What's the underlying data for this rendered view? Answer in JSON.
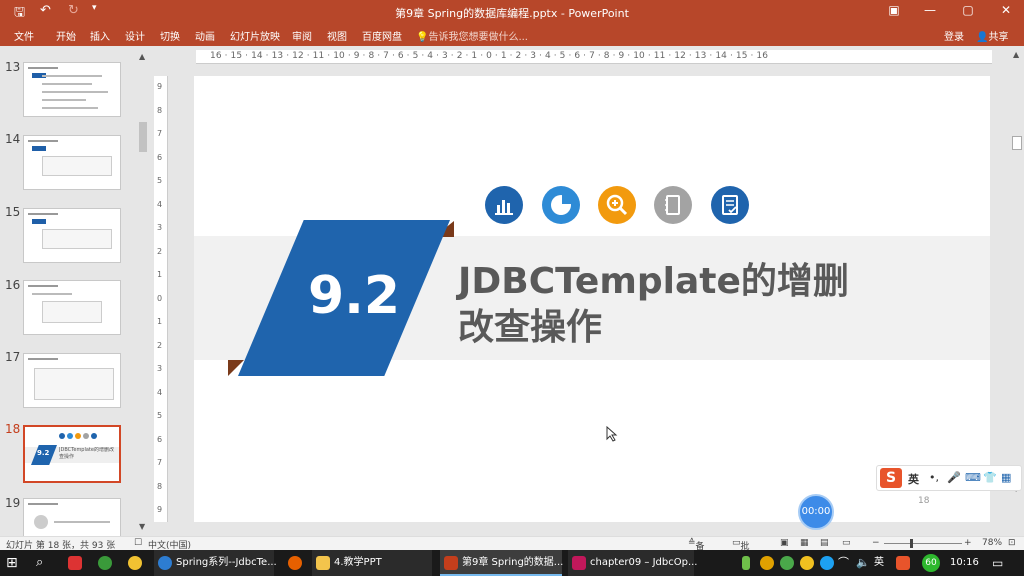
{
  "app": {
    "title": "第9章 Spring的数据库编程.pptx - PowerPoint"
  },
  "ribbon": {
    "tabs": [
      "文件",
      "开始",
      "插入",
      "设计",
      "切换",
      "动画",
      "幻灯片放映",
      "审阅",
      "视图",
      "百度网盘"
    ],
    "tell_me": "告诉我您想要做什么...",
    "login": "登录",
    "share": "共享"
  },
  "ruler": {
    "h": "16 · 15 · 14 · 13 · 12 · 11 · 10 · 9 · 8 · 7 · 6 · 5 · 4 · 3 · 2 · 1 · 0 · 1 · 2 · 3 · 4 · 5 · 6 · 7 · 8 · 9 · 10 · 11 · 12 · 13 · 14 · 15 · 16",
    "v": [
      "9",
      "8",
      "7",
      "6",
      "5",
      "4",
      "3",
      "2",
      "1",
      "0",
      "1",
      "2",
      "3",
      "4",
      "5",
      "6",
      "7",
      "8",
      "9"
    ]
  },
  "thumbs": [
    {
      "num": "13",
      "label": "9.x 9.3.1 Spring JDBC"
    },
    {
      "num": "14",
      "label": "9.x 9.3.2 Spring JDBC"
    },
    {
      "num": "15",
      "label": "9.x 9.3.3 Spring JDBC"
    },
    {
      "num": "16",
      "label": "9.x 9.3.4 Spring JDBC"
    },
    {
      "num": "17",
      "label": "9.x 9.3.5 Spring JDBC"
    },
    {
      "num": "18",
      "label": "JDBCTemplate的增删改查操作"
    },
    {
      "num": "19",
      "label": "9.x 9.3.7 insert方法"
    }
  ],
  "slide": {
    "number": "9.2",
    "title_line1": "JDBCTemplate的增删",
    "title_line2": "改查操作",
    "page": "18",
    "icons": [
      {
        "name": "bar-chart-icon",
        "color": "#1f64ad"
      },
      {
        "name": "pie-chart-icon",
        "color": "#2e8bd6"
      },
      {
        "name": "zoom-in-icon",
        "color": "#f29a0e"
      },
      {
        "name": "notebook-icon",
        "color": "#a3a3a3"
      },
      {
        "name": "checklist-icon",
        "color": "#1f64ad"
      }
    ]
  },
  "ime": {
    "lang": "英",
    "punct": "•,",
    "items": [
      "mic-icon",
      "keyboard-icon",
      "shirt-icon",
      "grid-icon"
    ]
  },
  "timer": "00:00",
  "status": {
    "slide": "幻灯片 第 18 张，共 93 张",
    "lang": "中文(中国)",
    "notes": "备注",
    "comments": "批注",
    "zoom": "78%"
  },
  "taskbar": {
    "items": [
      "Spring系列--JdbcTe...",
      "4.教学PPT",
      "第9章 Spring的数据...",
      "chapter09 – JdbcOp..."
    ],
    "badge": "60",
    "ime": "英",
    "time": "10:16"
  }
}
